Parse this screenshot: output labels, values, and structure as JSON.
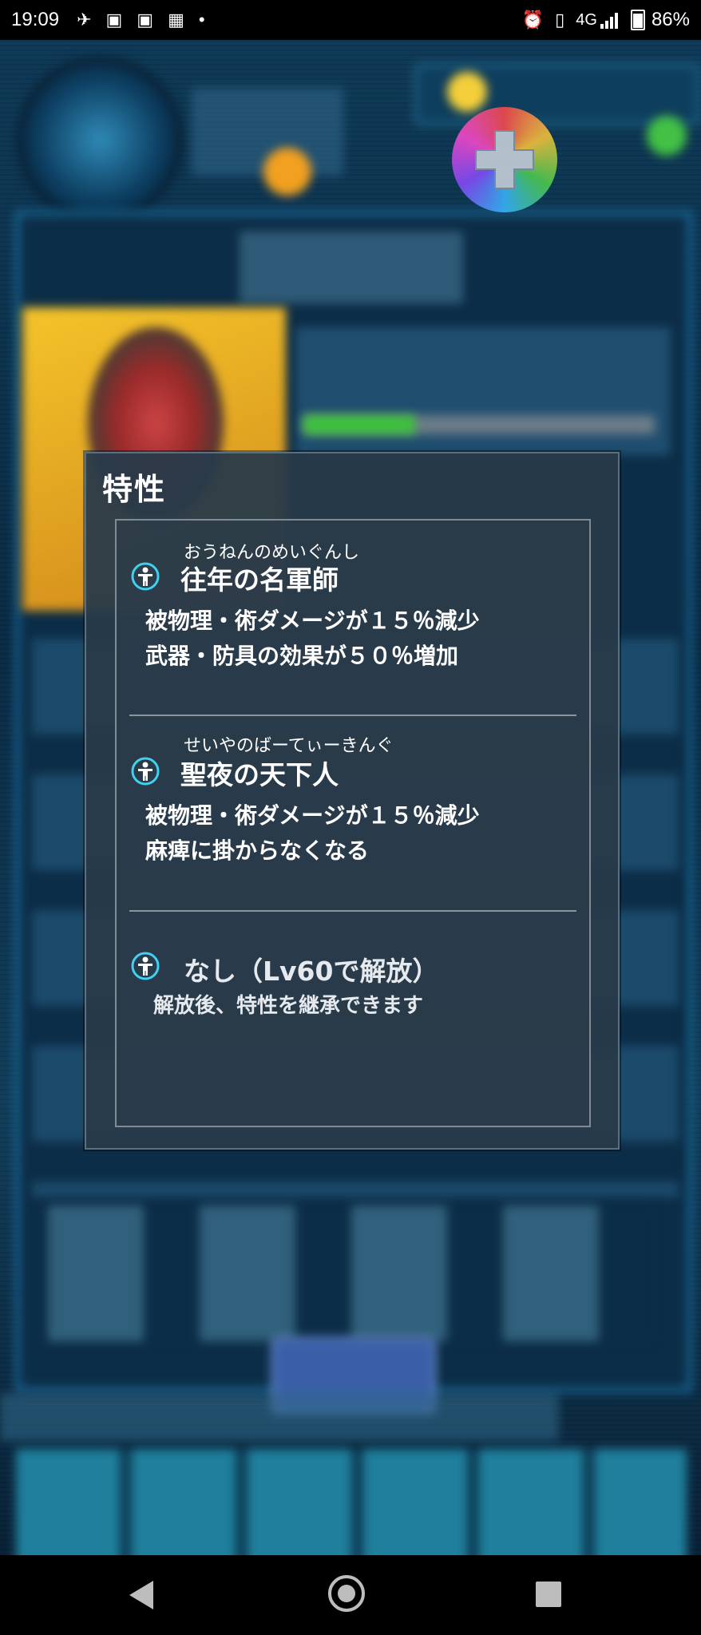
{
  "status_bar": {
    "time": "19:09",
    "left_icons": [
      "paper-plane-icon",
      "au-pay-icon",
      "au-pay-icon",
      "tiled-app-icon",
      "dot-icon"
    ],
    "network": "4G",
    "battery": "86%"
  },
  "dialog": {
    "title": "特性",
    "traits": [
      {
        "ruby": "おうねんのめいぐんし",
        "name": "往年の名軍師",
        "desc": [
          "被物理・術ダメージが１５％減少",
          "武器・防具の効果が５０％増加"
        ]
      },
      {
        "ruby": "せいやのばーてぃーきんぐ",
        "name": "聖夜の天下人",
        "desc": [
          "被物理・術ダメージが１５％減少",
          "麻痺に掛からなくなる"
        ]
      },
      {
        "ruby": "",
        "name": "なし（Lv60で解放）",
        "desc": [
          "解放後、特性を継承できます"
        ]
      }
    ]
  },
  "colors": {
    "dialog_bg": "#283a4a",
    "trait_icon": "#41d0f0"
  },
  "nav_bar": {
    "buttons": [
      "back-icon",
      "home-icon",
      "recent-apps-icon"
    ]
  }
}
